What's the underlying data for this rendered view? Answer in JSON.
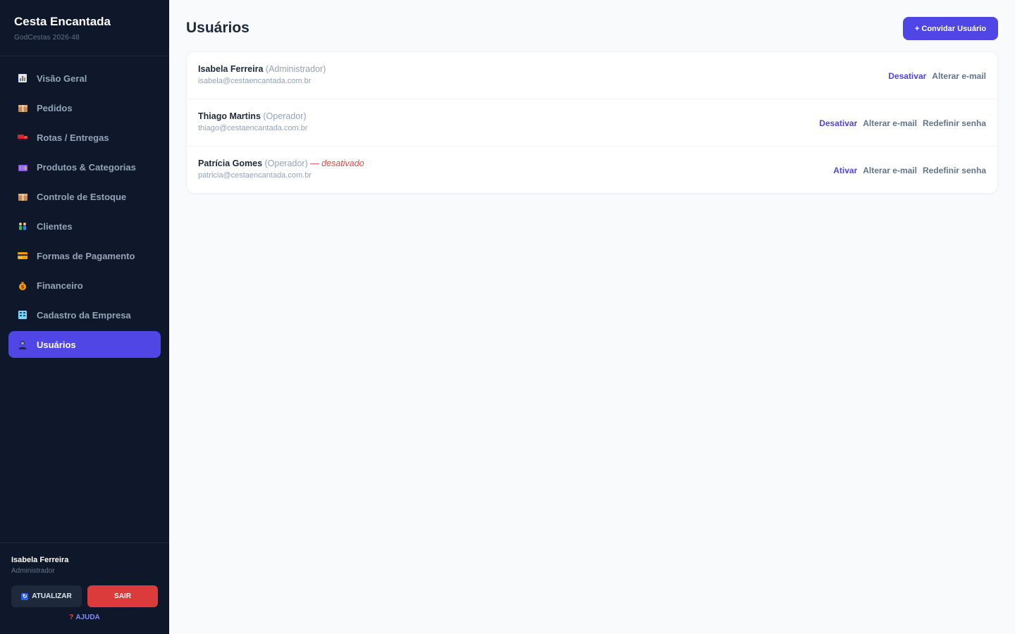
{
  "brand": {
    "title": "Cesta Encantada",
    "subtitle": "GodCestas 2026-48"
  },
  "nav": [
    {
      "label": "Visão Geral",
      "icon": "bar-chart-icon"
    },
    {
      "label": "Pedidos",
      "icon": "package-icon"
    },
    {
      "label": "Rotas / Entregas",
      "icon": "truck-icon"
    },
    {
      "label": "Produtos & Categorias",
      "icon": "shopping-icon"
    },
    {
      "label": "Controle de Estoque",
      "icon": "box-icon"
    },
    {
      "label": "Clientes",
      "icon": "people-icon"
    },
    {
      "label": "Formas de Pagamento",
      "icon": "credit-card-icon"
    },
    {
      "label": "Financeiro",
      "icon": "money-bag-icon"
    },
    {
      "label": "Cadastro da Empresa",
      "icon": "building-icon"
    },
    {
      "label": "Usuários",
      "icon": "user-icon",
      "active": true
    }
  ],
  "footer": {
    "user_name": "Isabela Ferreira",
    "user_role": "Administrador",
    "refresh_label": "ATUALIZAR",
    "logout_label": "SAIR",
    "help_label": "AJUDA"
  },
  "main": {
    "title": "Usuários",
    "invite_label": "+ Convidar Usuário"
  },
  "users": [
    {
      "name": "Isabela Ferreira",
      "role": "(Administrador)",
      "status": "",
      "email": "isabela@cestaencantada.com.br",
      "toggle_label": "Desativar",
      "change_email_label": "Alterar e-mail",
      "reset_password_label": ""
    },
    {
      "name": "Thiago Martins",
      "role": "(Operador)",
      "status": "",
      "email": "thiago@cestaencantada.com.br",
      "toggle_label": "Desativar",
      "change_email_label": "Alterar e-mail",
      "reset_password_label": "Redefinir senha"
    },
    {
      "name": "Patrícia Gomes",
      "role": "(Operador)",
      "status": "— desativado",
      "email": "patricia@cestaencantada.com.br",
      "toggle_label": "Ativar",
      "change_email_label": "Alterar e-mail",
      "reset_password_label": "Redefinir senha"
    }
  ],
  "colors": {
    "sidebar_bg": "#0f172a",
    "accent": "#4f46e5",
    "danger": "#dc3b3b",
    "page_bg": "#f8fafc"
  }
}
